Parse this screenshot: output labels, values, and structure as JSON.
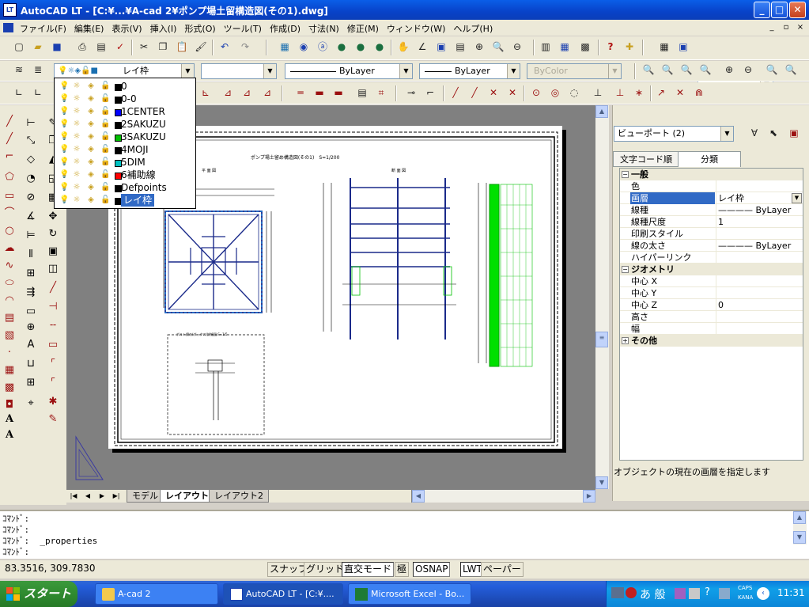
{
  "window": {
    "title": "AutoCAD LT - [C:¥...¥A-cad 2¥ポンプ場土留構造図(その1).dwg]",
    "app_icon_label": "LT",
    "minimize": "_",
    "maximize": "□",
    "close": "✕"
  },
  "menu": {
    "items": [
      "ファイル(F)",
      "編集(E)",
      "表示(V)",
      "挿入(I)",
      "形式(O)",
      "ツール(T)",
      "作成(D)",
      "寸法(N)",
      "修正(M)",
      "ウィンドウ(W)",
      "ヘルプ(H)"
    ],
    "doc_min": "_",
    "doc_restore": "▫",
    "doc_close": "×"
  },
  "toolbar_properties": {
    "layer_combo": "レイ枠",
    "color_combo": "",
    "linetype_combo": "ByLayer",
    "lineweight_combo": "ByLayer",
    "plotstyle_combo": "ByColor"
  },
  "layer_dropdown": {
    "layers": [
      {
        "name": "0",
        "color": "#000000"
      },
      {
        "name": "0-0",
        "color": "#000000"
      },
      {
        "name": "1CENTER",
        "color": "#0000ff"
      },
      {
        "name": "2SAKUZU",
        "color": "#000000"
      },
      {
        "name": "3SAKUZU",
        "color": "#00c000"
      },
      {
        "name": "4MOJI",
        "color": "#000000"
      },
      {
        "name": "5DIM",
        "color": "#00c0c0"
      },
      {
        "name": "6補助線",
        "color": "#ff0000"
      },
      {
        "name": "Defpoints",
        "color": "#000000"
      },
      {
        "name": "レイ枠",
        "color": "#000000",
        "selected": true
      }
    ]
  },
  "drawing": {
    "title": "ポンプ場土留め構造図(その1)　S=1/200",
    "plan_label": "平 面 図",
    "section_label": "断 面 図",
    "detail_label": "ボルト締め(ボックス)詳細図 S=1/5"
  },
  "tabs": [
    "モデル",
    "レイアウト1",
    "レイアウト2"
  ],
  "active_tab": "レイアウト1",
  "properties": {
    "object_combo": "ビューポート (2)",
    "tab_alpha": "文字コード順",
    "tab_category": "分類",
    "rows": [
      {
        "type": "cat",
        "key": "一般",
        "sign": "−"
      },
      {
        "key": "色",
        "value": ""
      },
      {
        "key": "画層",
        "value": "レイ枠",
        "highlight": true
      },
      {
        "key": "線種",
        "value": "———— ByLayer"
      },
      {
        "key": "線種尺度",
        "value": "1"
      },
      {
        "key": "印刷スタイル",
        "value": ""
      },
      {
        "key": "線の太さ",
        "value": "———— ByLayer"
      },
      {
        "key": "ハイパーリンク",
        "value": ""
      },
      {
        "type": "cat",
        "key": "ジオメトリ",
        "sign": "−"
      },
      {
        "key": "中心 X",
        "value": ""
      },
      {
        "key": "中心 Y",
        "value": ""
      },
      {
        "key": "中心 Z",
        "value": "0"
      },
      {
        "key": "高さ",
        "value": ""
      },
      {
        "key": "幅",
        "value": ""
      },
      {
        "type": "cat",
        "key": "その他",
        "sign": "+"
      }
    ],
    "description": "オブジェクトの現在の画層を指定します"
  },
  "command": {
    "lines": [
      "ｺﾏﾝﾄﾞ:",
      "ｺﾏﾝﾄﾞ:",
      "ｺﾏﾝﾄﾞ:  _properties",
      "ｺﾏﾝﾄﾞ:"
    ]
  },
  "status": {
    "coords": "83.3516,  309.7830",
    "snap": "スナップ",
    "grid": "グリッド",
    "ortho": "直交モード",
    "polar": "極",
    "osnap": "OSNAP",
    "lwt": "LWT",
    "paper": "ペーパー"
  },
  "taskbar": {
    "start": "スタート",
    "buttons": [
      "A-cad 2",
      "AutoCAD LT - [C:¥....",
      "Microsoft Excel - Bo..."
    ],
    "tray_ime": "あ 般",
    "caps": "CAPS",
    "kana": "KANA",
    "clock": "11:31"
  }
}
